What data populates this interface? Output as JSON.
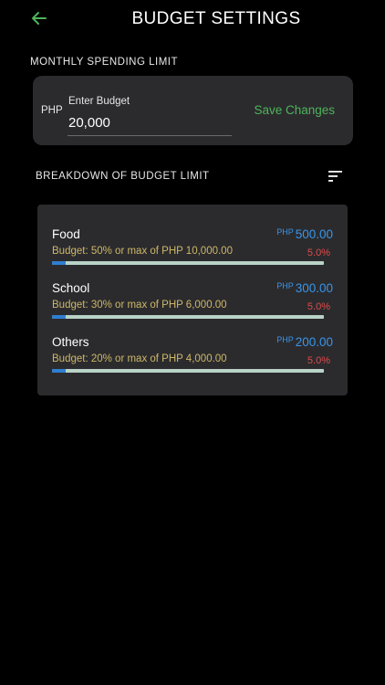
{
  "header": {
    "title": "BUDGET SETTINGS",
    "back_icon": "arrow-left-icon",
    "accent": "#4fb35a"
  },
  "monthly_limit": {
    "section_label": "MONTHLY SPENDING LIMIT",
    "currency": "PHP",
    "input_label": "Enter Budget",
    "value": "20,000",
    "save_label": "Save Changes"
  },
  "breakdown": {
    "section_label": "BREAKDOWN OF BUDGET LIMIT",
    "sort_icon": "sort-icon",
    "items": [
      {
        "name": "Food",
        "currency": "PHP",
        "amount": "500.00",
        "budget_text": "Budget: 50% or max of PHP 10,000.00",
        "percent": "5.0%",
        "progress": 0.05
      },
      {
        "name": "School",
        "currency": "PHP",
        "amount": "300.00",
        "budget_text": "Budget: 30% or max of PHP 6,000.00",
        "percent": "5.0%",
        "progress": 0.05
      },
      {
        "name": "Others",
        "currency": "PHP",
        "amount": "200.00",
        "budget_text": "Budget: 20% or max of PHP 4,000.00",
        "percent": "5.0%",
        "progress": 0.05
      }
    ]
  },
  "colors": {
    "amount": "#3a95e8",
    "budget_text": "#cdb768",
    "percent": "#e04a4a",
    "card": "#2b2b2e"
  }
}
